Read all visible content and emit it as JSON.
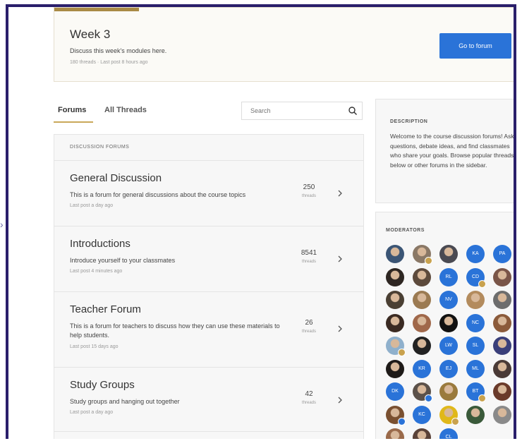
{
  "week": {
    "title": "Week 3",
    "description": "Discuss this week's modules here.",
    "meta": "180 threads · Last post 8 hours ago",
    "button_label": "Go to forum"
  },
  "tabs": [
    {
      "label": "Forums",
      "active": true
    },
    {
      "label": "All Threads",
      "active": false
    }
  ],
  "search": {
    "placeholder": "Search"
  },
  "forum_list": {
    "header": "DISCUSSION FORUMS",
    "forums": [
      {
        "title": "General Discussion",
        "description": "This is a forum for general discussions about the course topics",
        "meta": "Last post a day ago",
        "count": "250",
        "count_label": "threads"
      },
      {
        "title": "Introductions",
        "description": "Introduce yourself to your classmates",
        "meta": "Last post 4 minutes ago",
        "count": "8541",
        "count_label": "threads"
      },
      {
        "title": "Teacher Forum",
        "description": "This is a forum for teachers to discuss how they can use these materials to help students.",
        "meta": "Last post 15 days ago",
        "count": "26",
        "count_label": "threads"
      },
      {
        "title": "Study Groups",
        "description": "Study groups and hanging out together",
        "meta": "Last post a day ago",
        "count": "42",
        "count_label": "threads"
      }
    ]
  },
  "description_panel": {
    "heading": "DESCRIPTION",
    "text": "Welcome to the course discussion forums! Ask questions, debate ideas, and find classmates who share your goals. Browse popular threads below or other forums in the sidebar."
  },
  "moderators": {
    "heading": "MODERATORS",
    "avatars": [
      {
        "type": "photo",
        "color": "#3b5575",
        "badge": ""
      },
      {
        "type": "photo",
        "color": "#8a7866",
        "badge": "gold"
      },
      {
        "type": "photo",
        "color": "#4a4a52",
        "badge": ""
      },
      {
        "type": "initials",
        "text": "KA",
        "badge": ""
      },
      {
        "type": "initials",
        "text": "PA",
        "badge": ""
      },
      {
        "type": "photo",
        "color": "#2e2622",
        "badge": ""
      },
      {
        "type": "photo",
        "color": "#5d4a3c",
        "badge": ""
      },
      {
        "type": "initials",
        "text": "RL",
        "badge": ""
      },
      {
        "type": "initials",
        "text": "CD",
        "badge": "gold"
      },
      {
        "type": "photo",
        "color": "#7a5548",
        "badge": ""
      },
      {
        "type": "photo",
        "color": "#4a3f33",
        "badge": ""
      },
      {
        "type": "photo",
        "color": "#9b7a52",
        "badge": ""
      },
      {
        "type": "initials",
        "text": "NV",
        "badge": ""
      },
      {
        "type": "photo",
        "color": "#b38b5d",
        "badge": ""
      },
      {
        "type": "photo",
        "color": "#6d6d6d",
        "badge": ""
      },
      {
        "type": "photo",
        "color": "#3a2a22",
        "badge": ""
      },
      {
        "type": "photo",
        "color": "#a0684a",
        "badge": ""
      },
      {
        "type": "photo",
        "color": "#111111",
        "badge": ""
      },
      {
        "type": "initials",
        "text": "NC",
        "badge": ""
      },
      {
        "type": "photo",
        "color": "#8b5a3a",
        "badge": ""
      },
      {
        "type": "photo",
        "color": "#8fb0cc",
        "badge": "gold"
      },
      {
        "type": "photo",
        "color": "#222222",
        "badge": ""
      },
      {
        "type": "initials",
        "text": "LW",
        "badge": ""
      },
      {
        "type": "initials",
        "text": "SL",
        "badge": ""
      },
      {
        "type": "photo",
        "color": "#3a3f7a",
        "badge": ""
      },
      {
        "type": "photo",
        "color": "#1e1a18",
        "badge": ""
      },
      {
        "type": "initials",
        "text": "KR",
        "badge": ""
      },
      {
        "type": "initials",
        "text": "EJ",
        "badge": ""
      },
      {
        "type": "initials",
        "text": "ML",
        "badge": ""
      },
      {
        "type": "photo",
        "color": "#4a3a36",
        "badge": ""
      },
      {
        "type": "initials",
        "text": "DK",
        "badge": ""
      },
      {
        "type": "photo",
        "color": "#5b5149",
        "badge": "blue"
      },
      {
        "type": "photo",
        "color": "#9a7a3c",
        "badge": ""
      },
      {
        "type": "initials",
        "text": "BT",
        "badge": "gold"
      },
      {
        "type": "photo",
        "color": "#6a3a2a",
        "badge": ""
      },
      {
        "type": "photo",
        "color": "#7a5030",
        "badge": "blue"
      },
      {
        "type": "initials",
        "text": "KC",
        "badge": ""
      },
      {
        "type": "photo",
        "color": "#e0b81a",
        "badge": "gold"
      },
      {
        "type": "photo",
        "color": "#3a5a3a",
        "badge": ""
      },
      {
        "type": "photo",
        "color": "#8a8a8a",
        "badge": ""
      },
      {
        "type": "photo",
        "color": "#9a6a4a",
        "badge": "gold"
      },
      {
        "type": "photo",
        "color": "#5a4238",
        "badge": ""
      },
      {
        "type": "initials",
        "text": "CL",
        "badge": ""
      }
    ]
  }
}
